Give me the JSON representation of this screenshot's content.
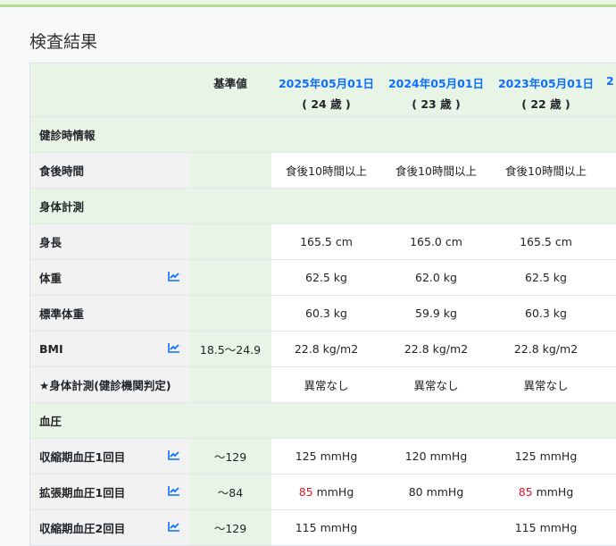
{
  "title": "検査結果",
  "header": {
    "base_label": "基準値",
    "columns": [
      {
        "date": "2025年05月01日",
        "age": "( 24 歳 )"
      },
      {
        "date": "2024年05月01日",
        "age": "( 23 歳 )"
      },
      {
        "date": "2023年05月01日",
        "age": "( 22 歳 )"
      },
      {
        "date": "2",
        "age": ""
      }
    ]
  },
  "rows": [
    {
      "type": "section",
      "label": "健診時情報"
    },
    {
      "type": "item",
      "label": "食後時間",
      "chart": false,
      "base": "",
      "values": [
        {
          "v": "食後10時間以上"
        },
        {
          "v": "食後10時間以上"
        },
        {
          "v": "食後10時間以上"
        }
      ]
    },
    {
      "type": "section",
      "label": "身体計測"
    },
    {
      "type": "item",
      "label": "身長",
      "chart": false,
      "base": "",
      "values": [
        {
          "v": "165.5 cm"
        },
        {
          "v": "165.0 cm"
        },
        {
          "v": "165.5 cm"
        }
      ]
    },
    {
      "type": "item",
      "label": "体重",
      "chart": true,
      "base": "",
      "values": [
        {
          "v": "62.5 kg"
        },
        {
          "v": "62.0 kg"
        },
        {
          "v": "62.5 kg"
        }
      ]
    },
    {
      "type": "item",
      "label": "標準体重",
      "chart": false,
      "base": "",
      "values": [
        {
          "v": "60.3 kg"
        },
        {
          "v": "59.9 kg"
        },
        {
          "v": "60.3 kg"
        }
      ]
    },
    {
      "type": "item",
      "label": "BMI",
      "chart": true,
      "base": "18.5〜24.9",
      "values": [
        {
          "v": "22.8 kg/m2"
        },
        {
          "v": "22.8 kg/m2"
        },
        {
          "v": "22.8 kg/m2"
        }
      ]
    },
    {
      "type": "item",
      "label": "★身体計測(健診機関判定)",
      "chart": false,
      "base": "",
      "values": [
        {
          "v": "異常なし"
        },
        {
          "v": "異常なし"
        },
        {
          "v": "異常なし"
        }
      ]
    },
    {
      "type": "section",
      "label": "血圧"
    },
    {
      "type": "item",
      "label": "収縮期血圧1回目",
      "chart": true,
      "base": "〜129",
      "values": [
        {
          "v": "125",
          "u": " mmHg"
        },
        {
          "v": "120",
          "u": " mmHg"
        },
        {
          "v": "125",
          "u": " mmHg"
        }
      ]
    },
    {
      "type": "item",
      "label": "拡張期血圧1回目",
      "chart": true,
      "base": "〜84",
      "values": [
        {
          "v": "85",
          "u": " mmHg",
          "abnormal": true
        },
        {
          "v": "80",
          "u": " mmHg"
        },
        {
          "v": "85",
          "u": " mmHg",
          "abnormal": true
        }
      ]
    },
    {
      "type": "item",
      "label": "収縮期血圧2回目",
      "chart": true,
      "base": "〜129",
      "values": [
        {
          "v": "115",
          "u": " mmHg"
        },
        {
          "v": "",
          "u": ""
        },
        {
          "v": "115",
          "u": " mmHg"
        }
      ]
    }
  ],
  "colors": {
    "link": "#0d6efd",
    "abnormal": "#e0192d",
    "section_bg": "#e8f4e5"
  }
}
